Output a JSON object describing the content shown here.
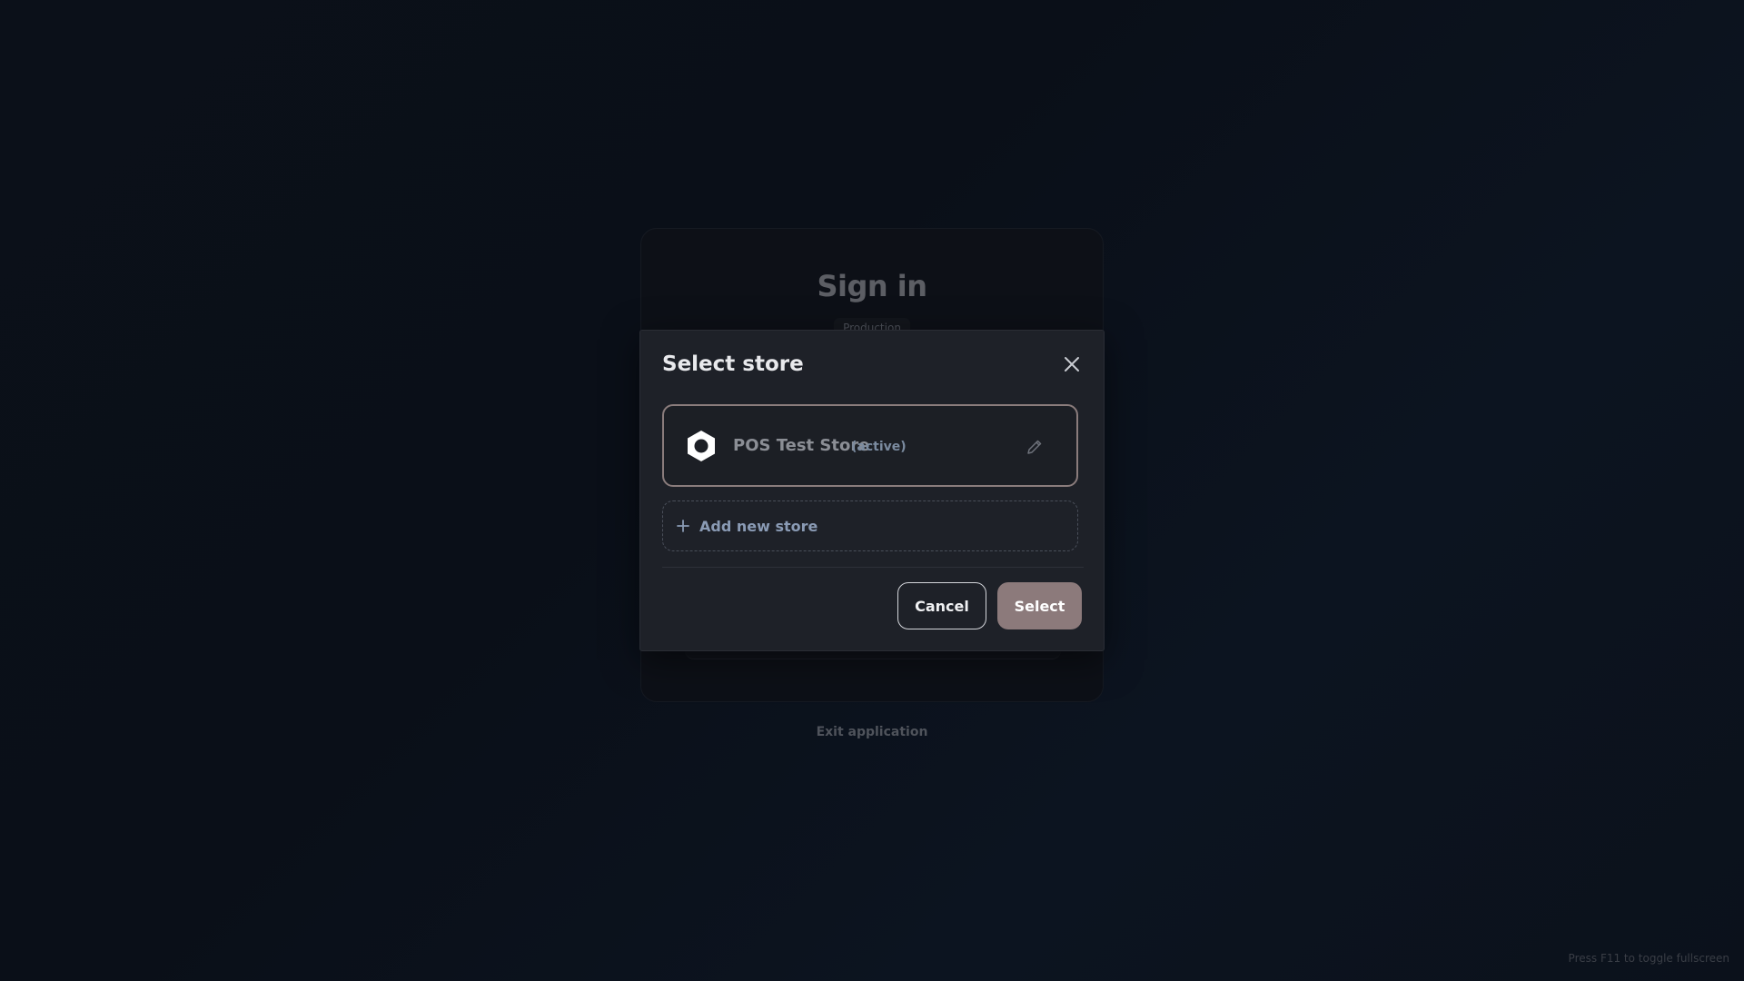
{
  "signin": {
    "title": "Sign in",
    "environment": "Production",
    "exit_label": "Exit application"
  },
  "hint": "Press F11 to toggle fullscreen",
  "modal": {
    "title": "Select store",
    "close_icon": "close-icon",
    "stores": [
      {
        "name": "POS Test Store",
        "status": "(active)",
        "selected": true,
        "icon": "hexagon-logo-icon"
      }
    ],
    "add_store_label": "Add new store",
    "cancel_label": "Cancel",
    "select_label": "Select"
  },
  "colors": {
    "accent": "#8c7a7b",
    "background": "#0b1019",
    "modal_bg": "#1e2128",
    "link": "#8a9bb5"
  }
}
